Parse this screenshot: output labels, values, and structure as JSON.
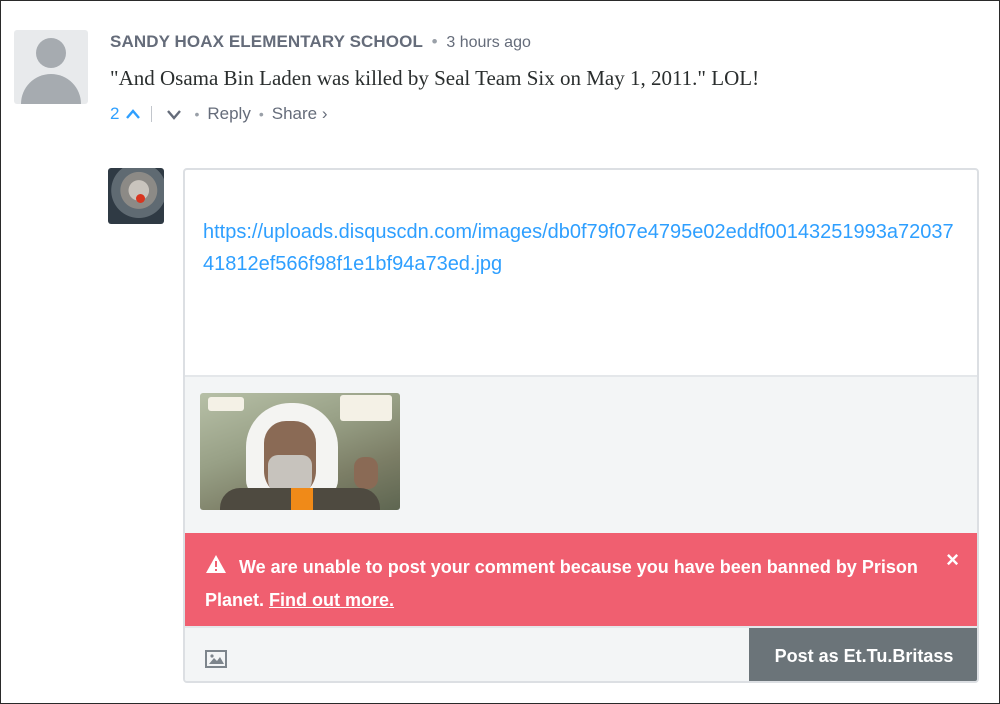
{
  "comment": {
    "author": "SANDY HOAX ELEMENTARY SCHOOL",
    "separator": "•",
    "timestamp": "3 hours ago",
    "body": "\"And Osama Bin Laden was killed by Seal Team Six on May 1, 2011.\" LOL!",
    "votes": "2",
    "upvote_icon": "chevron-up-icon",
    "downvote_icon": "chevron-down-icon",
    "reply_label": "Reply",
    "share_label": "Share ›"
  },
  "composer": {
    "text": "https://uploads.disquscdn.com/images/db0f79f07e4795e02eddf00143251993a7203741812ef566f98f1e1bf94a73ed.jpg",
    "attachment_icon": "image-thumbnail",
    "alert": {
      "message": "We are unable to post your comment because you have been banned by Prison Planet.",
      "link_text": "Find out more.",
      "close_label": "×",
      "icon": "warning-icon"
    },
    "image_button_icon": "image-icon",
    "post_label": "Post as Et.Tu.Britass"
  },
  "colors": {
    "link_blue": "#2e9fff",
    "meta_gray": "#656c7a",
    "alert_red": "#f05f70",
    "post_button": "#6b7479"
  }
}
